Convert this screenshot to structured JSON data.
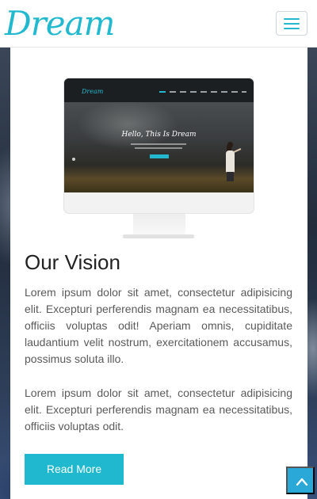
{
  "header": {
    "logo": "Dream",
    "menu_icon": "hamburger-icon"
  },
  "mockup": {
    "logo": "Dream",
    "headline": "Hello, This Is Dream"
  },
  "section": {
    "title": "Our Vision",
    "paragraphs": [
      "Lorem ipsum dolor sit amet, consectetur adipisicing elit. Excepturi perferendis magnam ea necessitatibus, officiis voluptas odit! Aperiam omnis, cupiditate laudantium velit nostrum, exercitationem accusamus, possimus soluta illo.",
      "Lorem ipsum dolor sit amet, consectetur adipisicing elit. Excepturi perferendis magnam ea necessitatibus, officiis voluptas odit."
    ],
    "button_label": "Read More"
  },
  "scroll_top": {
    "icon": "chevron-up-icon"
  },
  "colors": {
    "accent": "#1fb8cf",
    "scroll_button": "#2aa8d8",
    "text": "#5a5a5a",
    "heading": "#222222"
  }
}
